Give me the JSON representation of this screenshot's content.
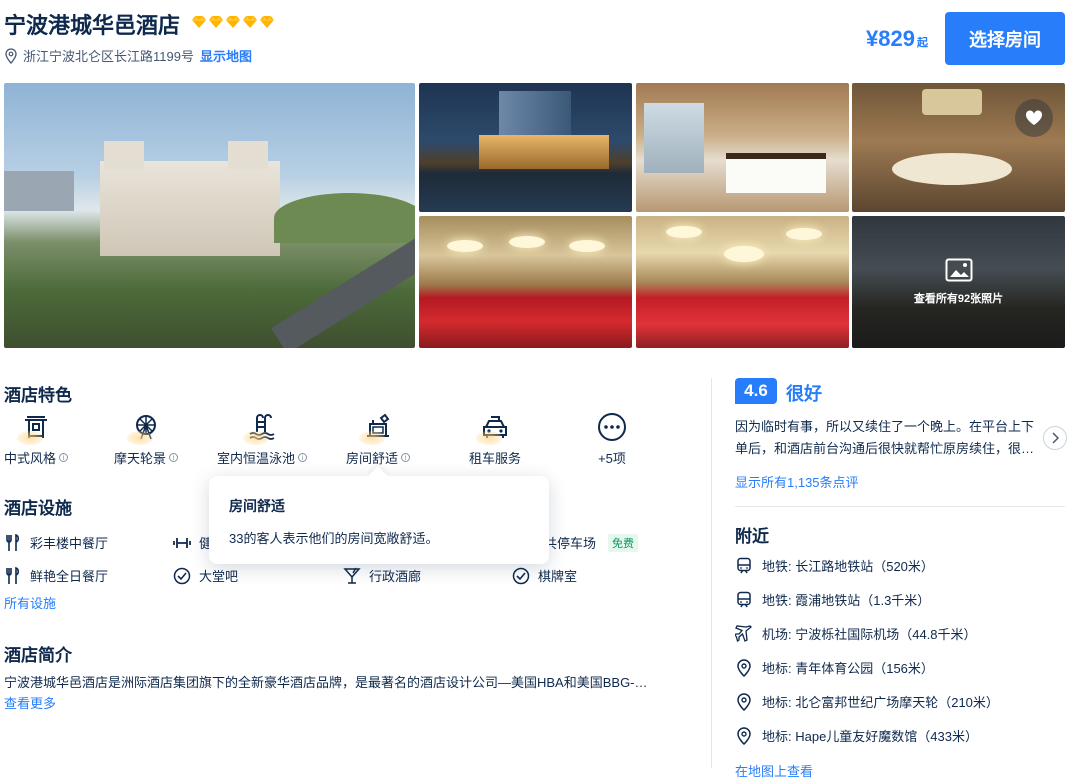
{
  "header": {
    "hotel_name": "宁波港城华邑酒店",
    "star_count": 5,
    "star_color": "#ffb400",
    "address": "浙江宁波北仑区长江路1199号",
    "show_map": "显示地图",
    "price": "¥829",
    "price_suffix": "起",
    "book_button": "选择房间"
  },
  "gallery": {
    "view_all": "查看所有92张照片",
    "favorite_icon": "heart-icon"
  },
  "features": {
    "title": "酒店特色",
    "items": [
      {
        "label": "中式风格",
        "icon": "chinese-gate-icon"
      },
      {
        "label": "摩天轮景",
        "icon": "ferris-wheel-icon"
      },
      {
        "label": "室内恒温泳池",
        "icon": "pool-icon"
      },
      {
        "label": "房间舒适",
        "icon": "desk-lamp-icon"
      },
      {
        "label": "租车服务",
        "icon": "taxi-icon"
      },
      {
        "label": "+5项",
        "icon": "more-icon"
      }
    ]
  },
  "tooltip": {
    "title": "房间舒适",
    "text": "33的客人表示他们的房间宽敞舒适。"
  },
  "facilities": {
    "title": "酒店设施",
    "items": [
      {
        "label": "彩丰楼中餐厅",
        "icon": "restaurant-icon"
      },
      {
        "label": "健",
        "icon": "dumbbell-icon"
      },
      {
        "label": "共停车场",
        "icon": "parking-icon",
        "badge": "免费"
      },
      {
        "label": "鲜艳全日餐厅",
        "icon": "restaurant-icon"
      },
      {
        "label": "大堂吧",
        "icon": "check-circle-icon"
      },
      {
        "label": "行政酒廊",
        "icon": "cocktail-icon"
      },
      {
        "label": "棋牌室",
        "icon": "check-circle-icon"
      }
    ],
    "all_link": "所有设施"
  },
  "intro": {
    "title": "酒店简介",
    "text": "宁波港城华邑酒店是洲际酒店集团旗下的全新豪华酒店品牌，是最著名的酒店设计公司—美国HBA和美国BBG-…",
    "more": "查看更多"
  },
  "review": {
    "score": "4.6",
    "word": "很好",
    "text": "因为临时有事，所以又续住了一个晚上。在平台上下单后，和酒店前台沟通后很快就帮忙原房续住，很…",
    "all_link": "显示所有1,135条点评"
  },
  "nearby": {
    "title": "附近",
    "items": [
      {
        "text": "地铁: 长江路地铁站（520米）",
        "icon": "metro-icon"
      },
      {
        "text": "地铁: 霞浦地铁站（1.3千米）",
        "icon": "metro-icon"
      },
      {
        "text": "机场: 宁波栎社国际机场（44.8千米）",
        "icon": "plane-icon"
      },
      {
        "text": "地标: 青年体育公园（156米）",
        "icon": "location-pin-icon"
      },
      {
        "text": "地标: 北仑富邦世纪广场摩天轮（210米）",
        "icon": "location-pin-icon"
      },
      {
        "text": "地标: Hape儿童友好魔数馆（433米）",
        "icon": "location-pin-icon"
      }
    ],
    "map_link": "在地图上查看"
  },
  "colors": {
    "accent": "#287dfa",
    "text": "#0f294d",
    "free_badge": "#0a9a5c"
  }
}
